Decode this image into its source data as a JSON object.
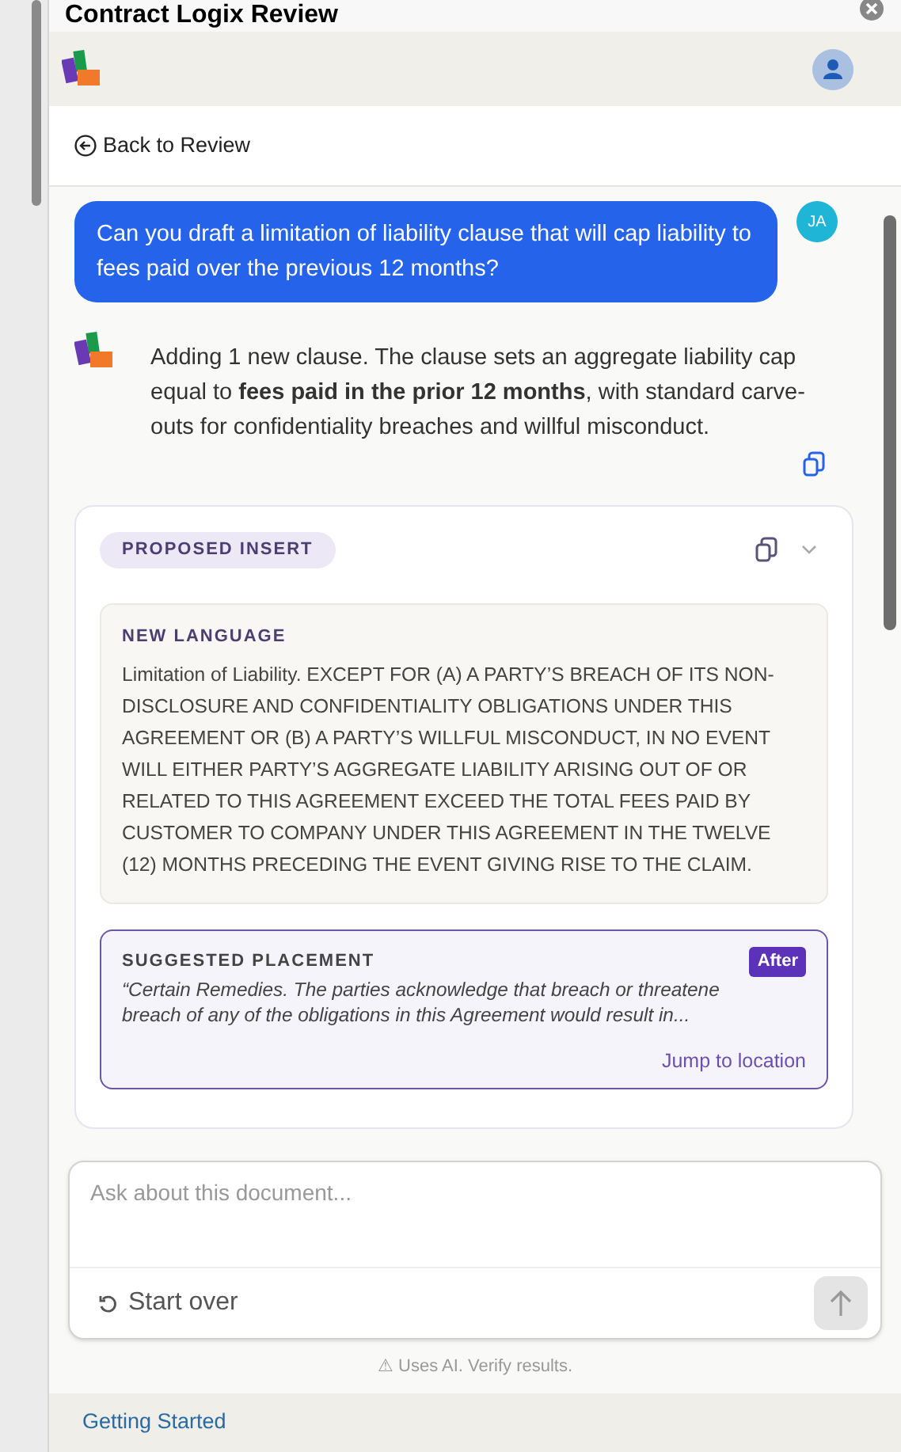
{
  "window": {
    "title": "Contract Logix Review"
  },
  "back_link": {
    "label": "Back to Review"
  },
  "messages": [
    {
      "kind": "user",
      "avatar": "JA",
      "text": "Can you draft a limitation of liability clause that will cap liability to fees paid over the previous 12 months?"
    },
    {
      "kind": "assistant",
      "text": "Adding 1 new clause. The clause sets an aggregate liability cap equal to **fees paid in the prior 12 months**, with standard carve-outs for confidentiality breaches and willful misconduct."
    }
  ],
  "proposal": {
    "badge": "PROPOSED INSERT",
    "expanded": true,
    "new_language": {
      "heading": "NEW LANGUAGE",
      "text": "Limitation of Liability. EXCEPT FOR (A) A PARTY’S BREACH OF ITS NON-DISCLOSURE AND CONFIDENTIALITY OBLIGATIONS UNDER THIS AGREEMENT OR (B) A PARTY’S WILLFUL MISCONDUCT, IN NO EVENT WILL EITHER PARTY’S AGGREGATE LIABILITY ARISING OUT OF OR RELATED TO THIS AGREEMENT EXCEED THE TOTAL FEES PAID BY CUSTOMER TO COMPANY UNDER THIS AGREEMENT IN THE TWELVE (12) MONTHS PRECEDING THE EVENT GIVING RISE TO THE CLAIM."
    },
    "placement": {
      "heading": "SUGGESTED PLACEMENT",
      "position": "After",
      "excerpt_lines": [
        "“Certain Remedies. The parties acknowledge that breach or threatene",
        "breach of any of the obligations in this Agreement would result in..."
      ],
      "link": "Jump to location"
    }
  },
  "composer": {
    "placeholder": "Ask about this document...",
    "start_over": "Start over",
    "send_disabled": true
  },
  "disclaimer": "⚠ Uses AI. Verify results.",
  "footer_link": "Getting Started"
}
